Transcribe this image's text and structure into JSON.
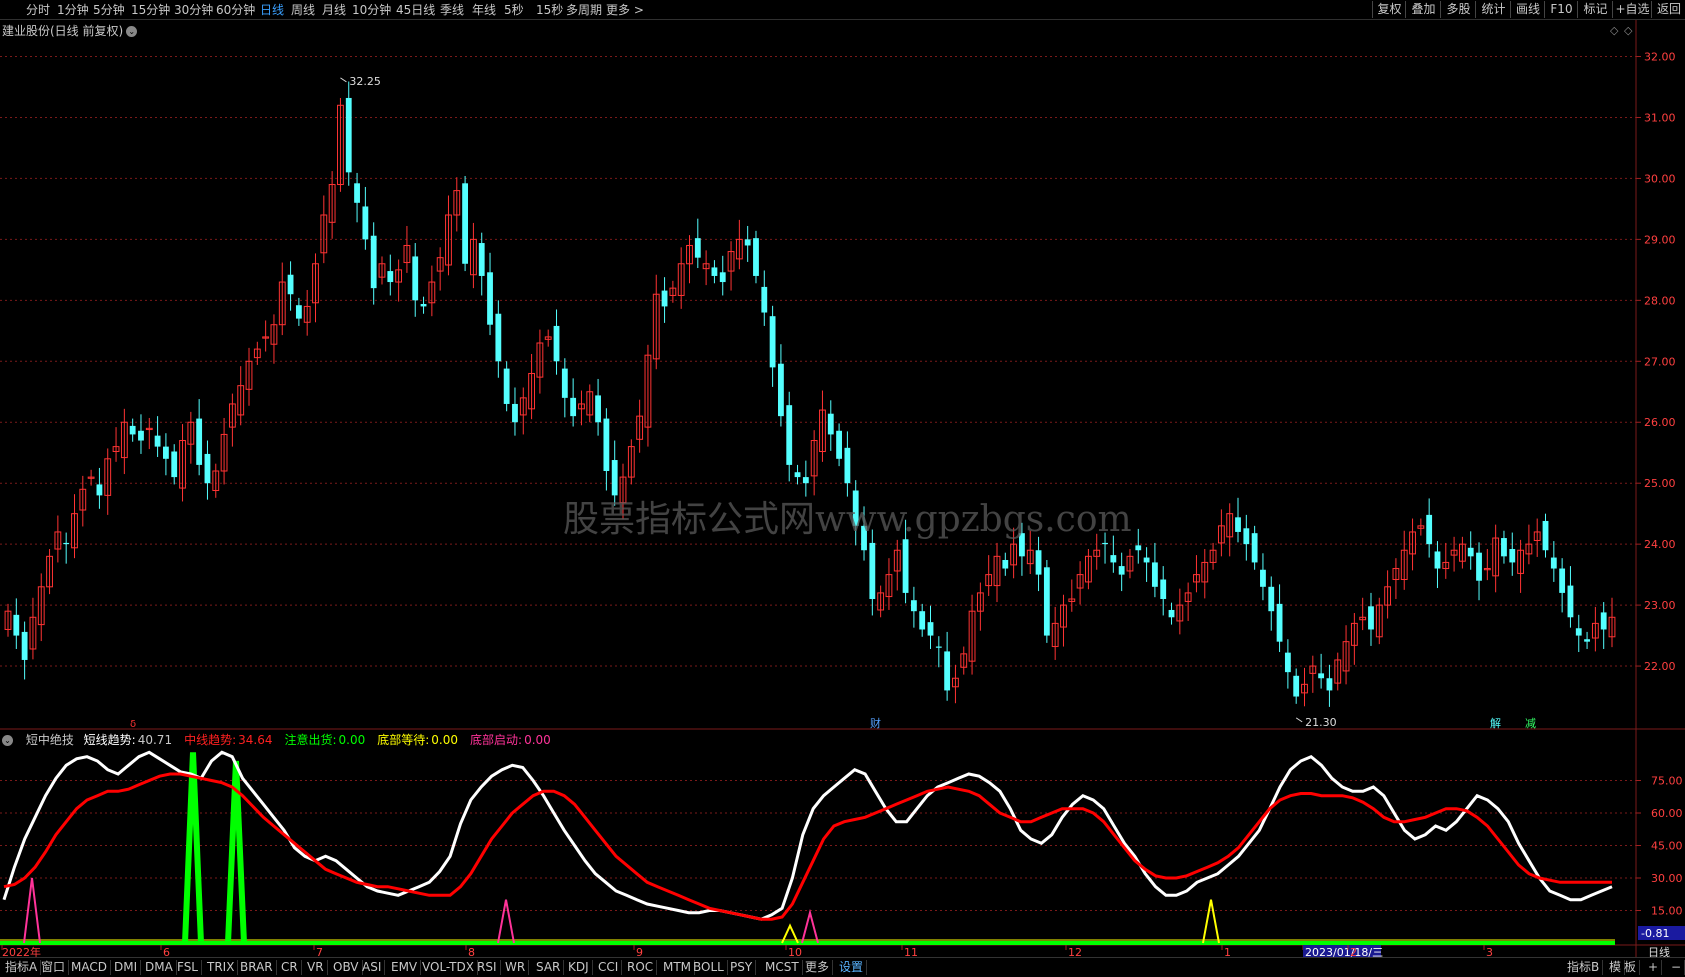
{
  "toolbar": {
    "periods": [
      "分时",
      "1分钟",
      "5分钟",
      "15分钟",
      "30分钟",
      "60分钟",
      "日线",
      "周线",
      "月线",
      "10分钟",
      "45日线",
      "季线",
      "年线",
      "5秒",
      "15秒",
      "多周期",
      "更多 >"
    ],
    "active_period": "日线",
    "right_buttons": [
      "复权",
      "叠加",
      "多股",
      "统计",
      "画线",
      "F10",
      "标记",
      "+自选",
      "返回"
    ]
  },
  "stock": {
    "title": "建业股份(日线 前复权)"
  },
  "watermark": "股票指标公式网www.gpzbgs.com",
  "price_axis": {
    "ticks": [
      "32.00",
      "31.00",
      "30.00",
      "29.00",
      "28.00",
      "27.00",
      "26.00",
      "25.00",
      "24.00",
      "23.00",
      "22.00"
    ],
    "ymin": 21.0,
    "ymax": 32.55
  },
  "annotations": {
    "high": "32.25",
    "low": "21.30",
    "event_markers": [
      "财",
      "解",
      "减"
    ]
  },
  "indicator": {
    "name": "短中绝技",
    "fields": [
      {
        "label": "短线趋势:",
        "value": "40.71",
        "color": "#ffffff"
      },
      {
        "label": "中线趋势:",
        "value": "34.64",
        "color": "#ff2020"
      },
      {
        "label": "注意出货:",
        "value": "0.00",
        "color": "#00ff00"
      },
      {
        "label": "底部等待:",
        "value": "0.00",
        "color": "#ffff00"
      },
      {
        "label": "底部启动:",
        "value": "0.00",
        "color": "#ff3399"
      }
    ],
    "axis_ticks": [
      "75.00",
      "60.00",
      "45.00",
      "30.00",
      "15.00"
    ],
    "current_value": "-0.81"
  },
  "date_axis": {
    "labels": [
      "2022年",
      "6",
      "7",
      "8",
      "9",
      "10",
      "11",
      "12",
      "1",
      "2023/01/18/三",
      "2",
      "3"
    ],
    "right_label": "日线"
  },
  "bottom_tabs": [
    "指标A",
    "窗口",
    "MACD",
    "DMI",
    "DMA",
    "FSL",
    "TRIX",
    "BRAR",
    "CR",
    "VR",
    "OBV",
    "ASI",
    "EMV",
    "VOL-TDX",
    "RSI",
    "WR",
    "SAR",
    "KDJ",
    "CCI",
    "ROC",
    "MTM",
    "BOLL",
    "PSY",
    "MCST",
    "更多",
    "设置"
  ],
  "bottom_right": [
    "指标B",
    "模",
    "板",
    "+",
    "−"
  ],
  "colors": {
    "up": "#ff3333",
    "down": "#54ffff",
    "grid": "#7a1a1a",
    "short": "#ffffff",
    "mid": "#ff0000",
    "sell": "#00ff00",
    "wait": "#ffff00",
    "start": "#ff3399"
  },
  "chart_data": [
    {
      "type": "candlestick",
      "title": "建业股份(日线 前复权)",
      "ylim": [
        21.0,
        32.55
      ],
      "close": [
        22.9,
        22.5,
        22.1,
        22.8,
        23.3,
        23.8,
        24.2,
        24.0,
        24.5,
        24.9,
        25.1,
        24.8,
        25.4,
        25.6,
        26.0,
        25.8,
        25.7,
        25.9,
        25.6,
        25.4,
        25.1,
        25.7,
        26.0,
        25.3,
        25.0,
        25.2,
        25.8,
        26.3,
        26.6,
        27.0,
        27.2,
        27.4,
        27.6,
        28.3,
        28.1,
        27.7,
        27.9,
        28.6,
        29.4,
        29.9,
        31.2,
        30.1,
        29.6,
        29.0,
        28.2,
        28.6,
        28.3,
        28.5,
        28.9,
        28.0,
        27.9,
        28.3,
        28.7,
        29.4,
        29.8,
        28.6,
        29.0,
        28.4,
        27.6,
        27.0,
        26.3,
        26.0,
        26.4,
        26.8,
        27.3,
        27.4,
        27.0,
        26.4,
        26.1,
        26.3,
        26.5,
        26.0,
        25.2,
        24.8,
        25.1,
        25.6,
        26.1,
        27.1,
        28.1,
        27.9,
        28.2,
        28.6,
        28.9,
        28.7,
        28.6,
        28.4,
        28.3,
        28.8,
        29.0,
        28.9,
        28.4,
        27.8,
        26.9,
        26.1,
        25.3,
        25.1,
        25.0,
        25.7,
        26.2,
        25.8,
        25.4,
        25.0,
        24.3,
        23.9,
        23.1,
        23.2,
        23.5,
        23.9,
        23.2,
        22.9,
        22.6,
        22.5,
        22.3,
        21.6,
        21.8,
        22.2,
        22.9,
        23.2,
        23.5,
        23.8,
        23.6,
        24.0,
        23.8,
        23.9,
        23.5,
        22.5,
        22.7,
        23.0,
        23.1,
        23.5,
        23.8,
        23.9,
        24.0,
        23.7,
        23.5,
        23.8,
        23.9,
        23.7,
        23.3,
        23.1,
        22.8,
        23.0,
        23.2,
        23.5,
        23.7,
        23.9,
        24.3,
        24.5,
        24.2,
        24.0,
        23.7,
        23.3,
        22.9,
        22.4,
        21.9,
        21.5,
        21.7,
        22.0,
        21.8,
        21.6,
        22.1,
        22.4,
        22.7,
        22.8,
        22.6,
        23.0,
        23.3,
        23.6,
        23.9,
        24.2,
        24.3,
        24.0,
        23.6,
        23.7,
        23.9,
        24.0,
        23.8,
        23.4,
        23.6,
        24.1,
        23.8,
        23.7,
        23.9,
        24.0,
        24.2,
        23.9,
        23.6,
        23.2,
        22.8,
        22.5,
        22.4,
        22.7,
        22.6,
        22.8
      ],
      "high_label": "32.25",
      "low_label": "21.30"
    },
    {
      "type": "line",
      "title": "短中绝技",
      "ylim": [
        0,
        90
      ],
      "series": [
        {
          "name": "短线趋势",
          "values": [
            20,
            35,
            48,
            58,
            68,
            76,
            82,
            85,
            86,
            84,
            80,
            78,
            82,
            86,
            88,
            85,
            82,
            79,
            78,
            76,
            84,
            88,
            86,
            76,
            70,
            64,
            58,
            52,
            44,
            40,
            38,
            40,
            38,
            34,
            30,
            26,
            24,
            23,
            22,
            24,
            26,
            28,
            33,
            40,
            55,
            66,
            72,
            77,
            80,
            82,
            81,
            75,
            68,
            60,
            52,
            45,
            38,
            32,
            28,
            24,
            22,
            20,
            18,
            17,
            16,
            15,
            14,
            14,
            15,
            15,
            14,
            13,
            12,
            11,
            13,
            16,
            30,
            50,
            62,
            68,
            72,
            76,
            80,
            78,
            70,
            62,
            56,
            56,
            62,
            68,
            72,
            74,
            76,
            78,
            77,
            74,
            70,
            62,
            52,
            48,
            46,
            50,
            58,
            64,
            68,
            66,
            62,
            54,
            46,
            40,
            32,
            26,
            22,
            22,
            24,
            28,
            30,
            32,
            36,
            40,
            46,
            52,
            62,
            72,
            80,
            84,
            86,
            82,
            76,
            72,
            70,
            70,
            72,
            68,
            60,
            52,
            48,
            50,
            54,
            52,
            56,
            62,
            68,
            66,
            62,
            56,
            46,
            38,
            30,
            24,
            22,
            20,
            20,
            22,
            24,
            26
          ]
        },
        {
          "name": "中线趋势",
          "values": [
            26,
            27,
            30,
            35,
            42,
            50,
            56,
            62,
            66,
            68,
            70,
            70,
            71,
            73,
            75,
            77,
            78,
            78,
            77,
            76,
            75,
            74,
            72,
            68,
            63,
            58,
            54,
            50,
            46,
            42,
            38,
            34,
            32,
            30,
            28,
            27,
            26,
            26,
            25,
            24,
            23,
            22,
            22,
            22,
            26,
            32,
            40,
            48,
            54,
            60,
            64,
            68,
            70,
            70,
            68,
            64,
            58,
            52,
            46,
            40,
            36,
            32,
            28,
            26,
            24,
            22,
            20,
            18,
            16,
            15,
            14,
            13,
            12,
            11,
            11,
            12,
            18,
            28,
            38,
            48,
            54,
            56,
            57,
            58,
            60,
            62,
            64,
            66,
            68,
            70,
            71,
            72,
            71,
            70,
            68,
            64,
            60,
            58,
            56,
            56,
            58,
            60,
            62,
            62,
            62,
            60,
            56,
            50,
            44,
            38,
            34,
            31,
            30,
            30,
            31,
            33,
            35,
            37,
            40,
            44,
            50,
            56,
            62,
            66,
            68,
            69,
            69,
            68,
            68,
            68,
            67,
            65,
            62,
            58,
            56,
            56,
            57,
            58,
            60,
            62,
            62,
            61,
            58,
            54,
            48,
            42,
            36,
            32,
            30,
            29,
            28,
            28,
            28,
            28,
            28,
            28
          ]
        }
      ]
    }
  ]
}
